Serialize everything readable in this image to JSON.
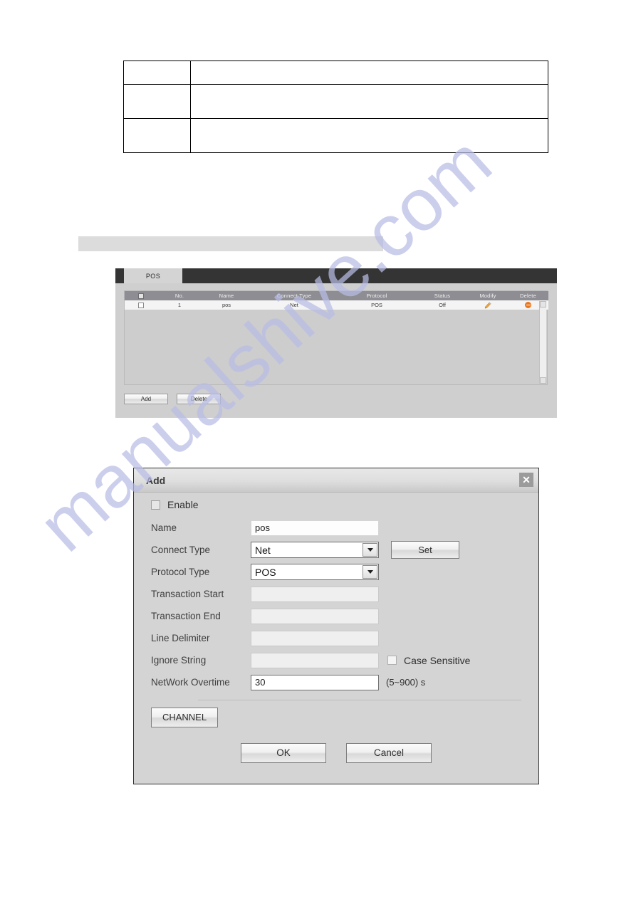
{
  "doc_table": {
    "rows": [
      {
        "col1": "",
        "col2": ""
      },
      {
        "col1": "",
        "col2": ""
      },
      {
        "col1": "",
        "col2": ""
      }
    ]
  },
  "caption_bar": {
    "text": ""
  },
  "pos_panel": {
    "tabs": [
      {
        "label": "POS",
        "active": true
      }
    ],
    "table": {
      "headers": [
        "",
        "No.",
        "Name",
        "Connect Type",
        "Protocol",
        "Status",
        "Modify",
        "Delete"
      ],
      "rows": [
        {
          "no": "1",
          "name": "pos",
          "connect_type": "Net",
          "protocol": "POS",
          "status": "Off",
          "modify_icon": "pencil-icon",
          "delete_icon": "delete-circle-icon"
        }
      ]
    },
    "buttons": {
      "add": "Add",
      "delete": "Delete"
    }
  },
  "dialog": {
    "title": "Add",
    "close_icon": "close-icon",
    "enable": {
      "label": "Enable",
      "checked": false
    },
    "fields": {
      "name": {
        "label": "Name",
        "value": "pos"
      },
      "connect_type": {
        "label": "Connect Type",
        "value": "Net"
      },
      "protocol_type": {
        "label": "Protocol Type",
        "value": "POS"
      },
      "transaction_start": {
        "label": "Transaction Start",
        "value": ""
      },
      "transaction_end": {
        "label": "Transaction End",
        "value": ""
      },
      "line_delimiter": {
        "label": "Line Delimiter",
        "value": ""
      },
      "ignore_string": {
        "label": "Ignore String",
        "value": ""
      },
      "network_overtime": {
        "label": "NetWork Overtime",
        "value": "30",
        "suffix": "(5~900) s"
      }
    },
    "case_sensitive": {
      "label": "Case Sensitive",
      "checked": false
    },
    "buttons": {
      "set": "Set",
      "channel": "CHANNEL",
      "ok": "OK",
      "cancel": "Cancel"
    }
  },
  "watermark": {
    "text": "manualshive.com",
    "color": "#b9bde4"
  }
}
